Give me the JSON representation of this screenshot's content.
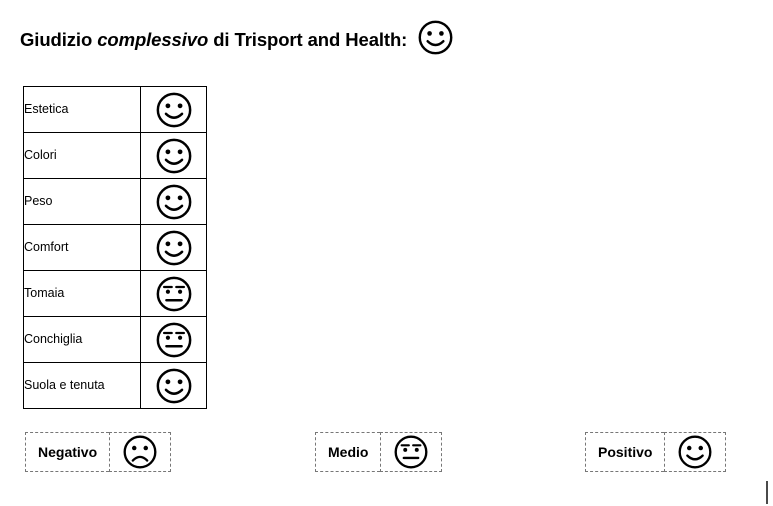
{
  "title": {
    "prefix": "Giudizio ",
    "emphasis": "complessivo",
    "suffix": " di Trisport and Health:",
    "overall_rating": "positive",
    "icon": "smiley-positive-icon"
  },
  "ratings_table": {
    "rows": [
      {
        "label": "Estetica",
        "rating": "positive",
        "icon": "smiley-positive-icon"
      },
      {
        "label": "Colori",
        "rating": "positive",
        "icon": "smiley-positive-icon"
      },
      {
        "label": "Peso",
        "rating": "positive",
        "icon": "smiley-positive-icon"
      },
      {
        "label": "Comfort",
        "rating": "positive",
        "icon": "smiley-positive-icon"
      },
      {
        "label": "Tomaia",
        "rating": "neutral",
        "icon": "smiley-neutral-icon"
      },
      {
        "label": "Conchiglia",
        "rating": "neutral",
        "icon": "smiley-neutral-icon"
      },
      {
        "label": "Suola e tenuta",
        "rating": "positive",
        "icon": "smiley-positive-icon"
      }
    ]
  },
  "legend": {
    "items": [
      {
        "label": "Negativo",
        "rating": "negative",
        "icon": "smiley-negative-icon"
      },
      {
        "label": "Medio",
        "rating": "neutral",
        "icon": "smiley-neutral-icon"
      },
      {
        "label": "Positivo",
        "rating": "positive",
        "icon": "smiley-positive-icon"
      }
    ]
  },
  "colors": {
    "ink": "#000000",
    "page_background": "#ffffff",
    "table_border": "#000000",
    "legend_border": "#777777"
  }
}
